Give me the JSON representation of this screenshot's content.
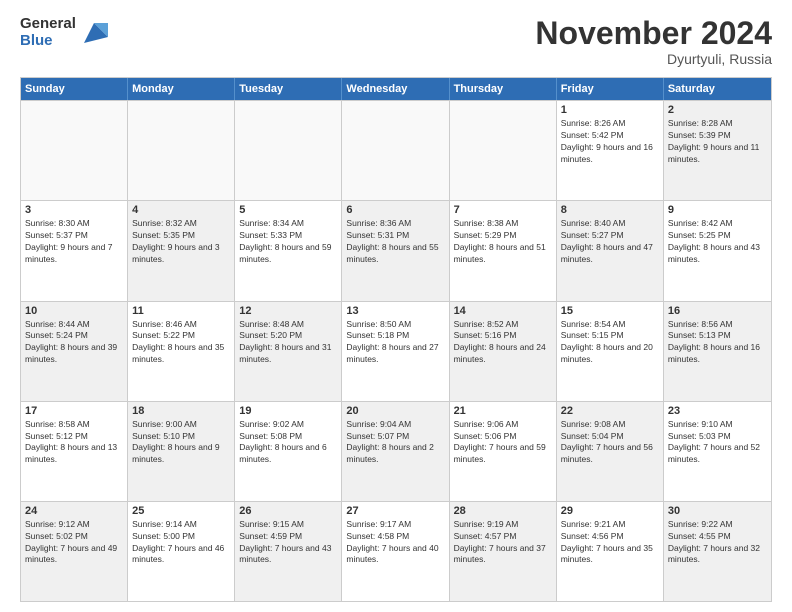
{
  "logo": {
    "general": "General",
    "blue": "Blue"
  },
  "title": "November 2024",
  "location": "Dyurtyuli, Russia",
  "weekdays": [
    "Sunday",
    "Monday",
    "Tuesday",
    "Wednesday",
    "Thursday",
    "Friday",
    "Saturday"
  ],
  "rows": [
    [
      {
        "day": "",
        "info": "",
        "empty": true
      },
      {
        "day": "",
        "info": "",
        "empty": true
      },
      {
        "day": "",
        "info": "",
        "empty": true
      },
      {
        "day": "",
        "info": "",
        "empty": true
      },
      {
        "day": "",
        "info": "",
        "empty": true
      },
      {
        "day": "1",
        "info": "Sunrise: 8:26 AM\nSunset: 5:42 PM\nDaylight: 9 hours and 16 minutes."
      },
      {
        "day": "2",
        "info": "Sunrise: 8:28 AM\nSunset: 5:39 PM\nDaylight: 9 hours and 11 minutes.",
        "shaded": true
      }
    ],
    [
      {
        "day": "3",
        "info": "Sunrise: 8:30 AM\nSunset: 5:37 PM\nDaylight: 9 hours and 7 minutes."
      },
      {
        "day": "4",
        "info": "Sunrise: 8:32 AM\nSunset: 5:35 PM\nDaylight: 9 hours and 3 minutes.",
        "shaded": true
      },
      {
        "day": "5",
        "info": "Sunrise: 8:34 AM\nSunset: 5:33 PM\nDaylight: 8 hours and 59 minutes."
      },
      {
        "day": "6",
        "info": "Sunrise: 8:36 AM\nSunset: 5:31 PM\nDaylight: 8 hours and 55 minutes.",
        "shaded": true
      },
      {
        "day": "7",
        "info": "Sunrise: 8:38 AM\nSunset: 5:29 PM\nDaylight: 8 hours and 51 minutes."
      },
      {
        "day": "8",
        "info": "Sunrise: 8:40 AM\nSunset: 5:27 PM\nDaylight: 8 hours and 47 minutes.",
        "shaded": true
      },
      {
        "day": "9",
        "info": "Sunrise: 8:42 AM\nSunset: 5:25 PM\nDaylight: 8 hours and 43 minutes."
      }
    ],
    [
      {
        "day": "10",
        "info": "Sunrise: 8:44 AM\nSunset: 5:24 PM\nDaylight: 8 hours and 39 minutes.",
        "shaded": true
      },
      {
        "day": "11",
        "info": "Sunrise: 8:46 AM\nSunset: 5:22 PM\nDaylight: 8 hours and 35 minutes."
      },
      {
        "day": "12",
        "info": "Sunrise: 8:48 AM\nSunset: 5:20 PM\nDaylight: 8 hours and 31 minutes.",
        "shaded": true
      },
      {
        "day": "13",
        "info": "Sunrise: 8:50 AM\nSunset: 5:18 PM\nDaylight: 8 hours and 27 minutes."
      },
      {
        "day": "14",
        "info": "Sunrise: 8:52 AM\nSunset: 5:16 PM\nDaylight: 8 hours and 24 minutes.",
        "shaded": true
      },
      {
        "day": "15",
        "info": "Sunrise: 8:54 AM\nSunset: 5:15 PM\nDaylight: 8 hours and 20 minutes."
      },
      {
        "day": "16",
        "info": "Sunrise: 8:56 AM\nSunset: 5:13 PM\nDaylight: 8 hours and 16 minutes.",
        "shaded": true
      }
    ],
    [
      {
        "day": "17",
        "info": "Sunrise: 8:58 AM\nSunset: 5:12 PM\nDaylight: 8 hours and 13 minutes."
      },
      {
        "day": "18",
        "info": "Sunrise: 9:00 AM\nSunset: 5:10 PM\nDaylight: 8 hours and 9 minutes.",
        "shaded": true
      },
      {
        "day": "19",
        "info": "Sunrise: 9:02 AM\nSunset: 5:08 PM\nDaylight: 8 hours and 6 minutes."
      },
      {
        "day": "20",
        "info": "Sunrise: 9:04 AM\nSunset: 5:07 PM\nDaylight: 8 hours and 2 minutes.",
        "shaded": true
      },
      {
        "day": "21",
        "info": "Sunrise: 9:06 AM\nSunset: 5:06 PM\nDaylight: 7 hours and 59 minutes."
      },
      {
        "day": "22",
        "info": "Sunrise: 9:08 AM\nSunset: 5:04 PM\nDaylight: 7 hours and 56 minutes.",
        "shaded": true
      },
      {
        "day": "23",
        "info": "Sunrise: 9:10 AM\nSunset: 5:03 PM\nDaylight: 7 hours and 52 minutes."
      }
    ],
    [
      {
        "day": "24",
        "info": "Sunrise: 9:12 AM\nSunset: 5:02 PM\nDaylight: 7 hours and 49 minutes.",
        "shaded": true
      },
      {
        "day": "25",
        "info": "Sunrise: 9:14 AM\nSunset: 5:00 PM\nDaylight: 7 hours and 46 minutes."
      },
      {
        "day": "26",
        "info": "Sunrise: 9:15 AM\nSunset: 4:59 PM\nDaylight: 7 hours and 43 minutes.",
        "shaded": true
      },
      {
        "day": "27",
        "info": "Sunrise: 9:17 AM\nSunset: 4:58 PM\nDaylight: 7 hours and 40 minutes."
      },
      {
        "day": "28",
        "info": "Sunrise: 9:19 AM\nSunset: 4:57 PM\nDaylight: 7 hours and 37 minutes.",
        "shaded": true
      },
      {
        "day": "29",
        "info": "Sunrise: 9:21 AM\nSunset: 4:56 PM\nDaylight: 7 hours and 35 minutes."
      },
      {
        "day": "30",
        "info": "Sunrise: 9:22 AM\nSunset: 4:55 PM\nDaylight: 7 hours and 32 minutes.",
        "shaded": true
      }
    ]
  ]
}
